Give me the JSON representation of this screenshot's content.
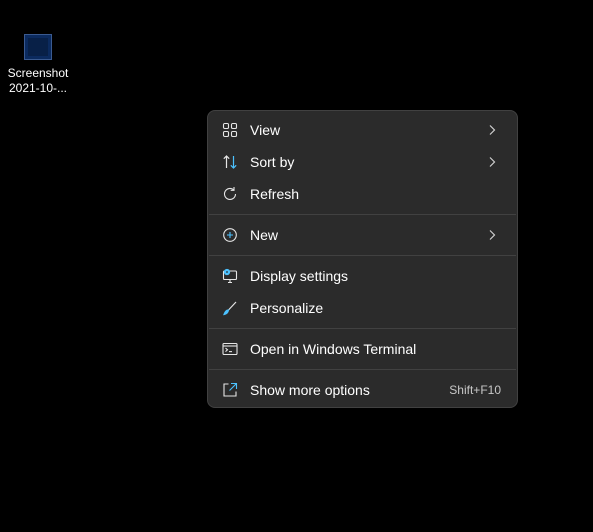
{
  "desktop": {
    "icon": {
      "label_line1": "Screenshot",
      "label_line2": "2021-10-..."
    }
  },
  "context_menu": {
    "items": [
      {
        "label": "View",
        "icon": "grid-icon",
        "submenu": true
      },
      {
        "label": "Sort by",
        "icon": "sort-icon",
        "submenu": true
      },
      {
        "label": "Refresh",
        "icon": "refresh-icon"
      },
      {
        "label": "New",
        "icon": "plus-circle-icon",
        "submenu": true
      },
      {
        "label": "Display settings",
        "icon": "display-settings-icon"
      },
      {
        "label": "Personalize",
        "icon": "brush-icon"
      },
      {
        "label": "Open in Windows Terminal",
        "icon": "terminal-icon"
      },
      {
        "label": "Show more options",
        "icon": "open-external-icon",
        "shortcut": "Shift+F10"
      }
    ]
  },
  "colors": {
    "menu_background": "#2b2b2b",
    "menu_border": "#414141",
    "accent_blue": "#4cc2ff",
    "desktop_background": "#000000"
  }
}
